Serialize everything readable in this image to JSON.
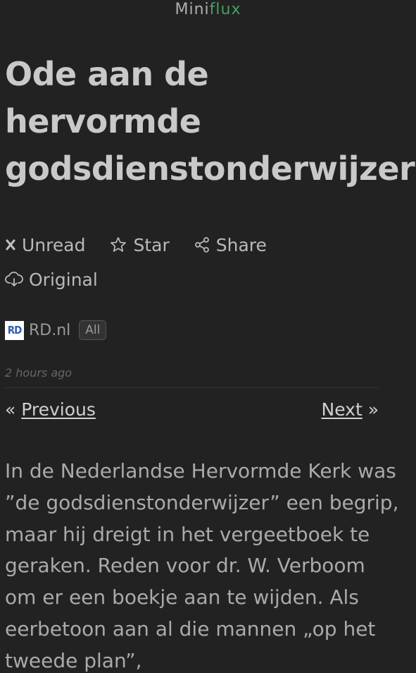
{
  "header": {
    "brand_prefix": "Mini",
    "brand_suffix": "flux",
    "accent_color": "#4a9e62"
  },
  "entry": {
    "title_lines": [
      "Ode aan de",
      "hervormde",
      "godsdienstonderwijzer"
    ],
    "actions": {
      "unread": {
        "label": "Unread",
        "icon": "x-icon"
      },
      "star": {
        "label": "Star",
        "icon": "star-icon"
      },
      "share": {
        "label": "Share",
        "icon": "share-icon"
      },
      "original": {
        "label": "Original",
        "icon": "cloud-download-icon"
      }
    },
    "feed": {
      "icon_text": "RD",
      "title": "RD.nl",
      "category": "All"
    },
    "date": "2 hours ago",
    "pagination": {
      "prev_arrow": "«",
      "prev_label": "Previous",
      "next_label": "Next",
      "next_arrow": "»"
    },
    "content": "In de Nederlandse Hervormde Kerk was ”de godsdienstonderwijzer” een begrip, maar hij dreigt in het vergeetboek te geraken. Reden voor dr. W. Verboom om er een boekje aan te wijden. Als eerbetoon aan al die mannen „op het tweede plan”,"
  }
}
